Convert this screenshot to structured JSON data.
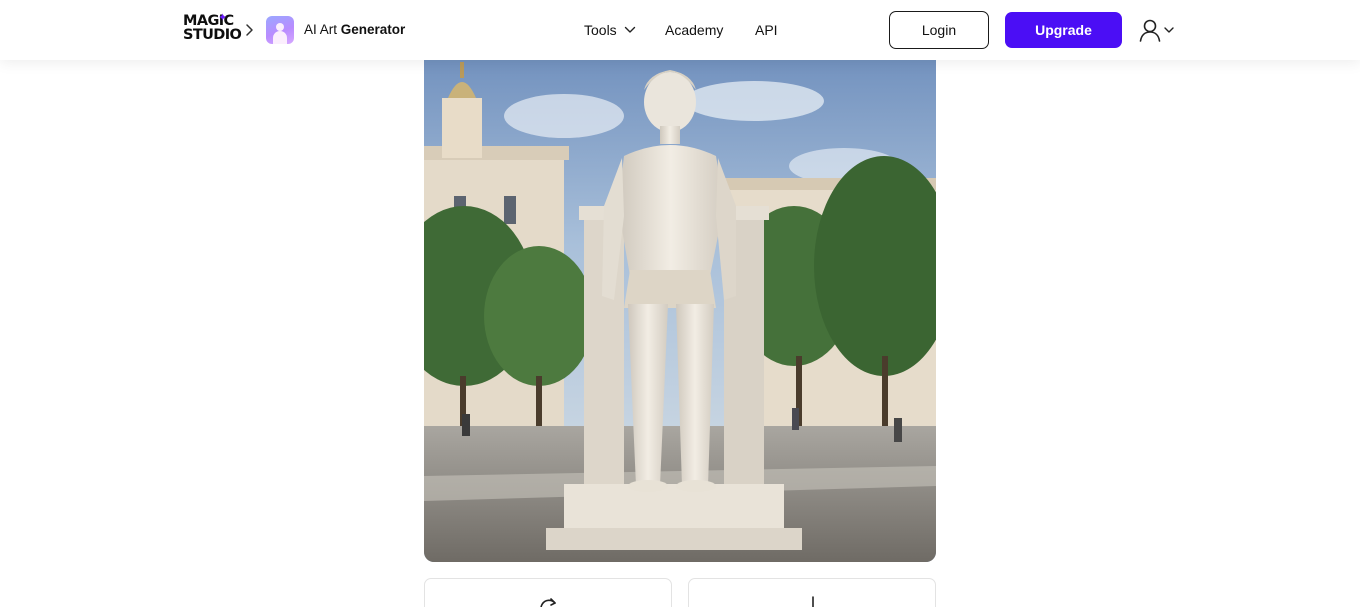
{
  "header": {
    "logo_line1": "MAGIC",
    "logo_line2": "STUDIO",
    "app_name_light": "AI Art ",
    "app_name_bold": "Generator",
    "nav": {
      "tools": "Tools",
      "academy": "Academy",
      "api": "API"
    },
    "login_label": "Login",
    "upgrade_label": "Upgrade"
  },
  "colors": {
    "brand_accent": "#4b0ef5",
    "logo_spark": "#6b1cff"
  },
  "icons": {
    "breadcrumb": "chevron-right-icon",
    "tools_dropdown": "chevron-down-icon",
    "user": "user-icon",
    "regenerate": "refresh-icon",
    "download": "download-icon"
  }
}
